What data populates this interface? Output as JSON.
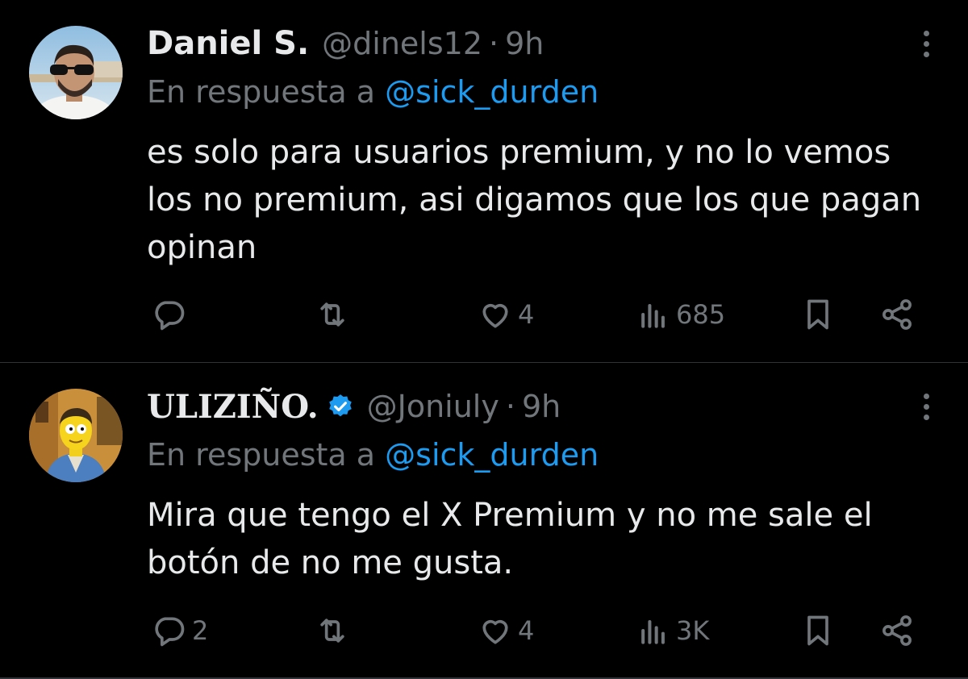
{
  "tweets": [
    {
      "name": "Daniel S.",
      "handle": "@dinels12",
      "separator": "·",
      "time": "9h",
      "verified": false,
      "replying_prefix": "En respuesta a",
      "replying_to": "@sick_durden",
      "text": "es solo para usuarios premium, y no lo vemos los no premium, asi digamos que los que pagan opinan",
      "stats": {
        "replies": "",
        "retweets": "",
        "likes": "4",
        "views": "685"
      }
    },
    {
      "name": "ULIZIÑO.",
      "handle": "@Joniuly",
      "separator": "·",
      "time": "9h",
      "verified": true,
      "replying_prefix": "En respuesta a",
      "replying_to": "@sick_durden",
      "text": "Mira que tengo el X Premium y no me sale el botón de no me gusta.",
      "stats": {
        "replies": "2",
        "retweets": "",
        "likes": "4",
        "views": "3K"
      }
    }
  ],
  "colors": {
    "background": "#000000",
    "text": "#e7e9ea",
    "muted": "#71767b",
    "accent": "#1d9bf0",
    "divider": "#2f3336"
  },
  "icons": [
    "reply-icon",
    "retweet-icon",
    "like-icon",
    "views-icon",
    "bookmark-icon",
    "share-icon",
    "more-icon",
    "verified-badge-icon"
  ]
}
